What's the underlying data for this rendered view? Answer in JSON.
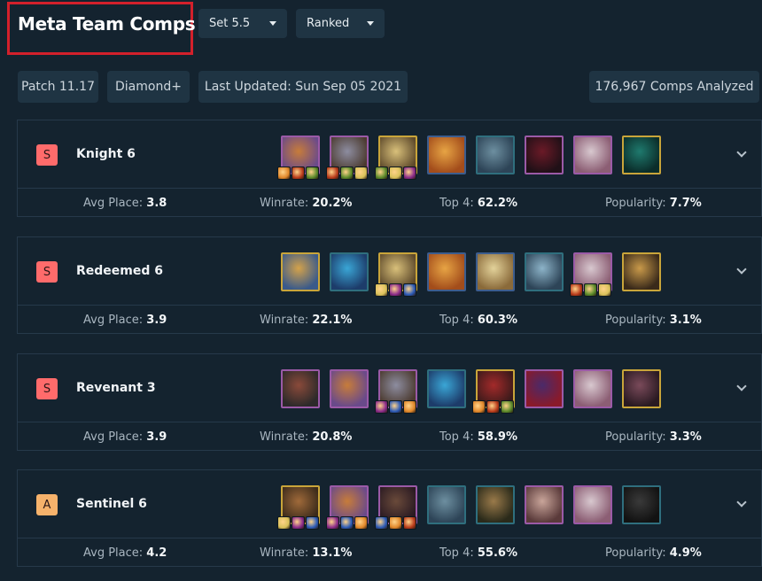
{
  "header": {
    "title": "Meta Team Comps",
    "set_dropdown": "Set 5.5",
    "mode_dropdown": "Ranked"
  },
  "info": {
    "patch": "Patch 11.17",
    "rank": "Diamond+",
    "updated": "Last Updated: Sun Sep 05 2021",
    "analyzed": "176,967 Comps Analyzed"
  },
  "labels": {
    "avg_place": "Avg Place:",
    "winrate": "Winrate:",
    "top4": "Top 4:",
    "popularity": "Popularity:"
  },
  "comps": [
    {
      "tier": "S",
      "tier_color": "#ff6b6b",
      "name": "Knight 6",
      "avg_place": "3.8",
      "winrate": "20.2%",
      "top4": "62.2%",
      "popularity": "7.7%",
      "champions": [
        {
          "border": "purple",
          "colors": [
            "#c77c3a",
            "#6a4a8a"
          ],
          "items": 3
        },
        {
          "border": "purple",
          "colors": [
            "#8d8da0",
            "#4b3a2f"
          ],
          "items": 3
        },
        {
          "border": "gold",
          "colors": [
            "#d9c07a",
            "#5e4a2b"
          ],
          "items": 3
        },
        {
          "border": "blue",
          "colors": [
            "#e7a444",
            "#a34d1b"
          ],
          "items": 0
        },
        {
          "border": "teal",
          "colors": [
            "#6d8fa0",
            "#2d4457"
          ],
          "items": 0
        },
        {
          "border": "purple",
          "colors": [
            "#6b1a27",
            "#201017"
          ],
          "items": 0
        },
        {
          "border": "purple",
          "colors": [
            "#d8c8cf",
            "#8c5e74"
          ],
          "items": 0
        },
        {
          "border": "gold",
          "colors": [
            "#1f7a6e",
            "#0b2d2a"
          ],
          "items": 0
        }
      ]
    },
    {
      "tier": "S",
      "tier_color": "#ff6b6b",
      "name": "Redeemed 6",
      "avg_place": "3.9",
      "winrate": "22.1%",
      "top4": "60.3%",
      "popularity": "3.1%",
      "champions": [
        {
          "border": "gold",
          "colors": [
            "#d4a24a",
            "#3a5a8a"
          ],
          "items": 0
        },
        {
          "border": "teal",
          "colors": [
            "#3aa6d6",
            "#1d3c6a"
          ],
          "items": 0
        },
        {
          "border": "gold",
          "colors": [
            "#d9c07a",
            "#5e4a2b"
          ],
          "items": 3
        },
        {
          "border": "blue",
          "colors": [
            "#e7a444",
            "#a34d1b"
          ],
          "items": 0
        },
        {
          "border": "blue",
          "colors": [
            "#e3d29a",
            "#8a6a3a"
          ],
          "items": 0
        },
        {
          "border": "teal",
          "colors": [
            "#8db4c9",
            "#2d4457"
          ],
          "items": 0
        },
        {
          "border": "purple",
          "colors": [
            "#d8c8cf",
            "#8c5e74"
          ],
          "items": 3
        },
        {
          "border": "gold",
          "colors": [
            "#c99a4a",
            "#3a2a1a"
          ],
          "items": 0
        }
      ]
    },
    {
      "tier": "S",
      "tier_color": "#ff6b6b",
      "name": "Revenant 3",
      "avg_place": "3.9",
      "winrate": "20.8%",
      "top4": "58.9%",
      "popularity": "3.3%",
      "champions": [
        {
          "border": "purple",
          "colors": [
            "#8a4a3a",
            "#2d2a2a"
          ],
          "items": 0
        },
        {
          "border": "purple",
          "colors": [
            "#c77c3a",
            "#6a4a8a"
          ],
          "items": 0
        },
        {
          "border": "purple",
          "colors": [
            "#8d8da0",
            "#4b3a2f"
          ],
          "items": 3
        },
        {
          "border": "teal",
          "colors": [
            "#3aa6d6",
            "#1d3c6a"
          ],
          "items": 0
        },
        {
          "border": "gold",
          "colors": [
            "#a32a2a",
            "#3a1a1a"
          ],
          "items": 3
        },
        {
          "border": "purple",
          "colors": [
            "#4a2a6a",
            "#8a1a2a"
          ],
          "items": 0
        },
        {
          "border": "purple",
          "colors": [
            "#d8c8cf",
            "#8c5e74"
          ],
          "items": 0
        },
        {
          "border": "gold",
          "colors": [
            "#7a4a5a",
            "#2a1a22"
          ],
          "items": 0
        }
      ]
    },
    {
      "tier": "A",
      "tier_color": "#f6b26b",
      "name": "Sentinel 6",
      "avg_place": "4.2",
      "winrate": "13.1%",
      "top4": "55.6%",
      "popularity": "4.9%",
      "champions": [
        {
          "border": "gold",
          "colors": [
            "#a06a3a",
            "#3a2a1a"
          ],
          "items": 3
        },
        {
          "border": "purple",
          "colors": [
            "#c77c3a",
            "#6a4a8a"
          ],
          "items": 3
        },
        {
          "border": "purple",
          "colors": [
            "#6a4a3a",
            "#2a1a22"
          ],
          "items": 3
        },
        {
          "border": "teal",
          "colors": [
            "#6d8fa0",
            "#2d4457"
          ],
          "items": 0
        },
        {
          "border": "teal",
          "colors": [
            "#9a7a4a",
            "#2a2a1a"
          ],
          "items": 0
        },
        {
          "border": "purple",
          "colors": [
            "#c9a59a",
            "#5a3a3a"
          ],
          "items": 0
        },
        {
          "border": "purple",
          "colors": [
            "#d8c8cf",
            "#8c5e74"
          ],
          "items": 0
        },
        {
          "border": "teal",
          "colors": [
            "#3a3a3a",
            "#121212"
          ],
          "items": 0
        }
      ]
    }
  ]
}
